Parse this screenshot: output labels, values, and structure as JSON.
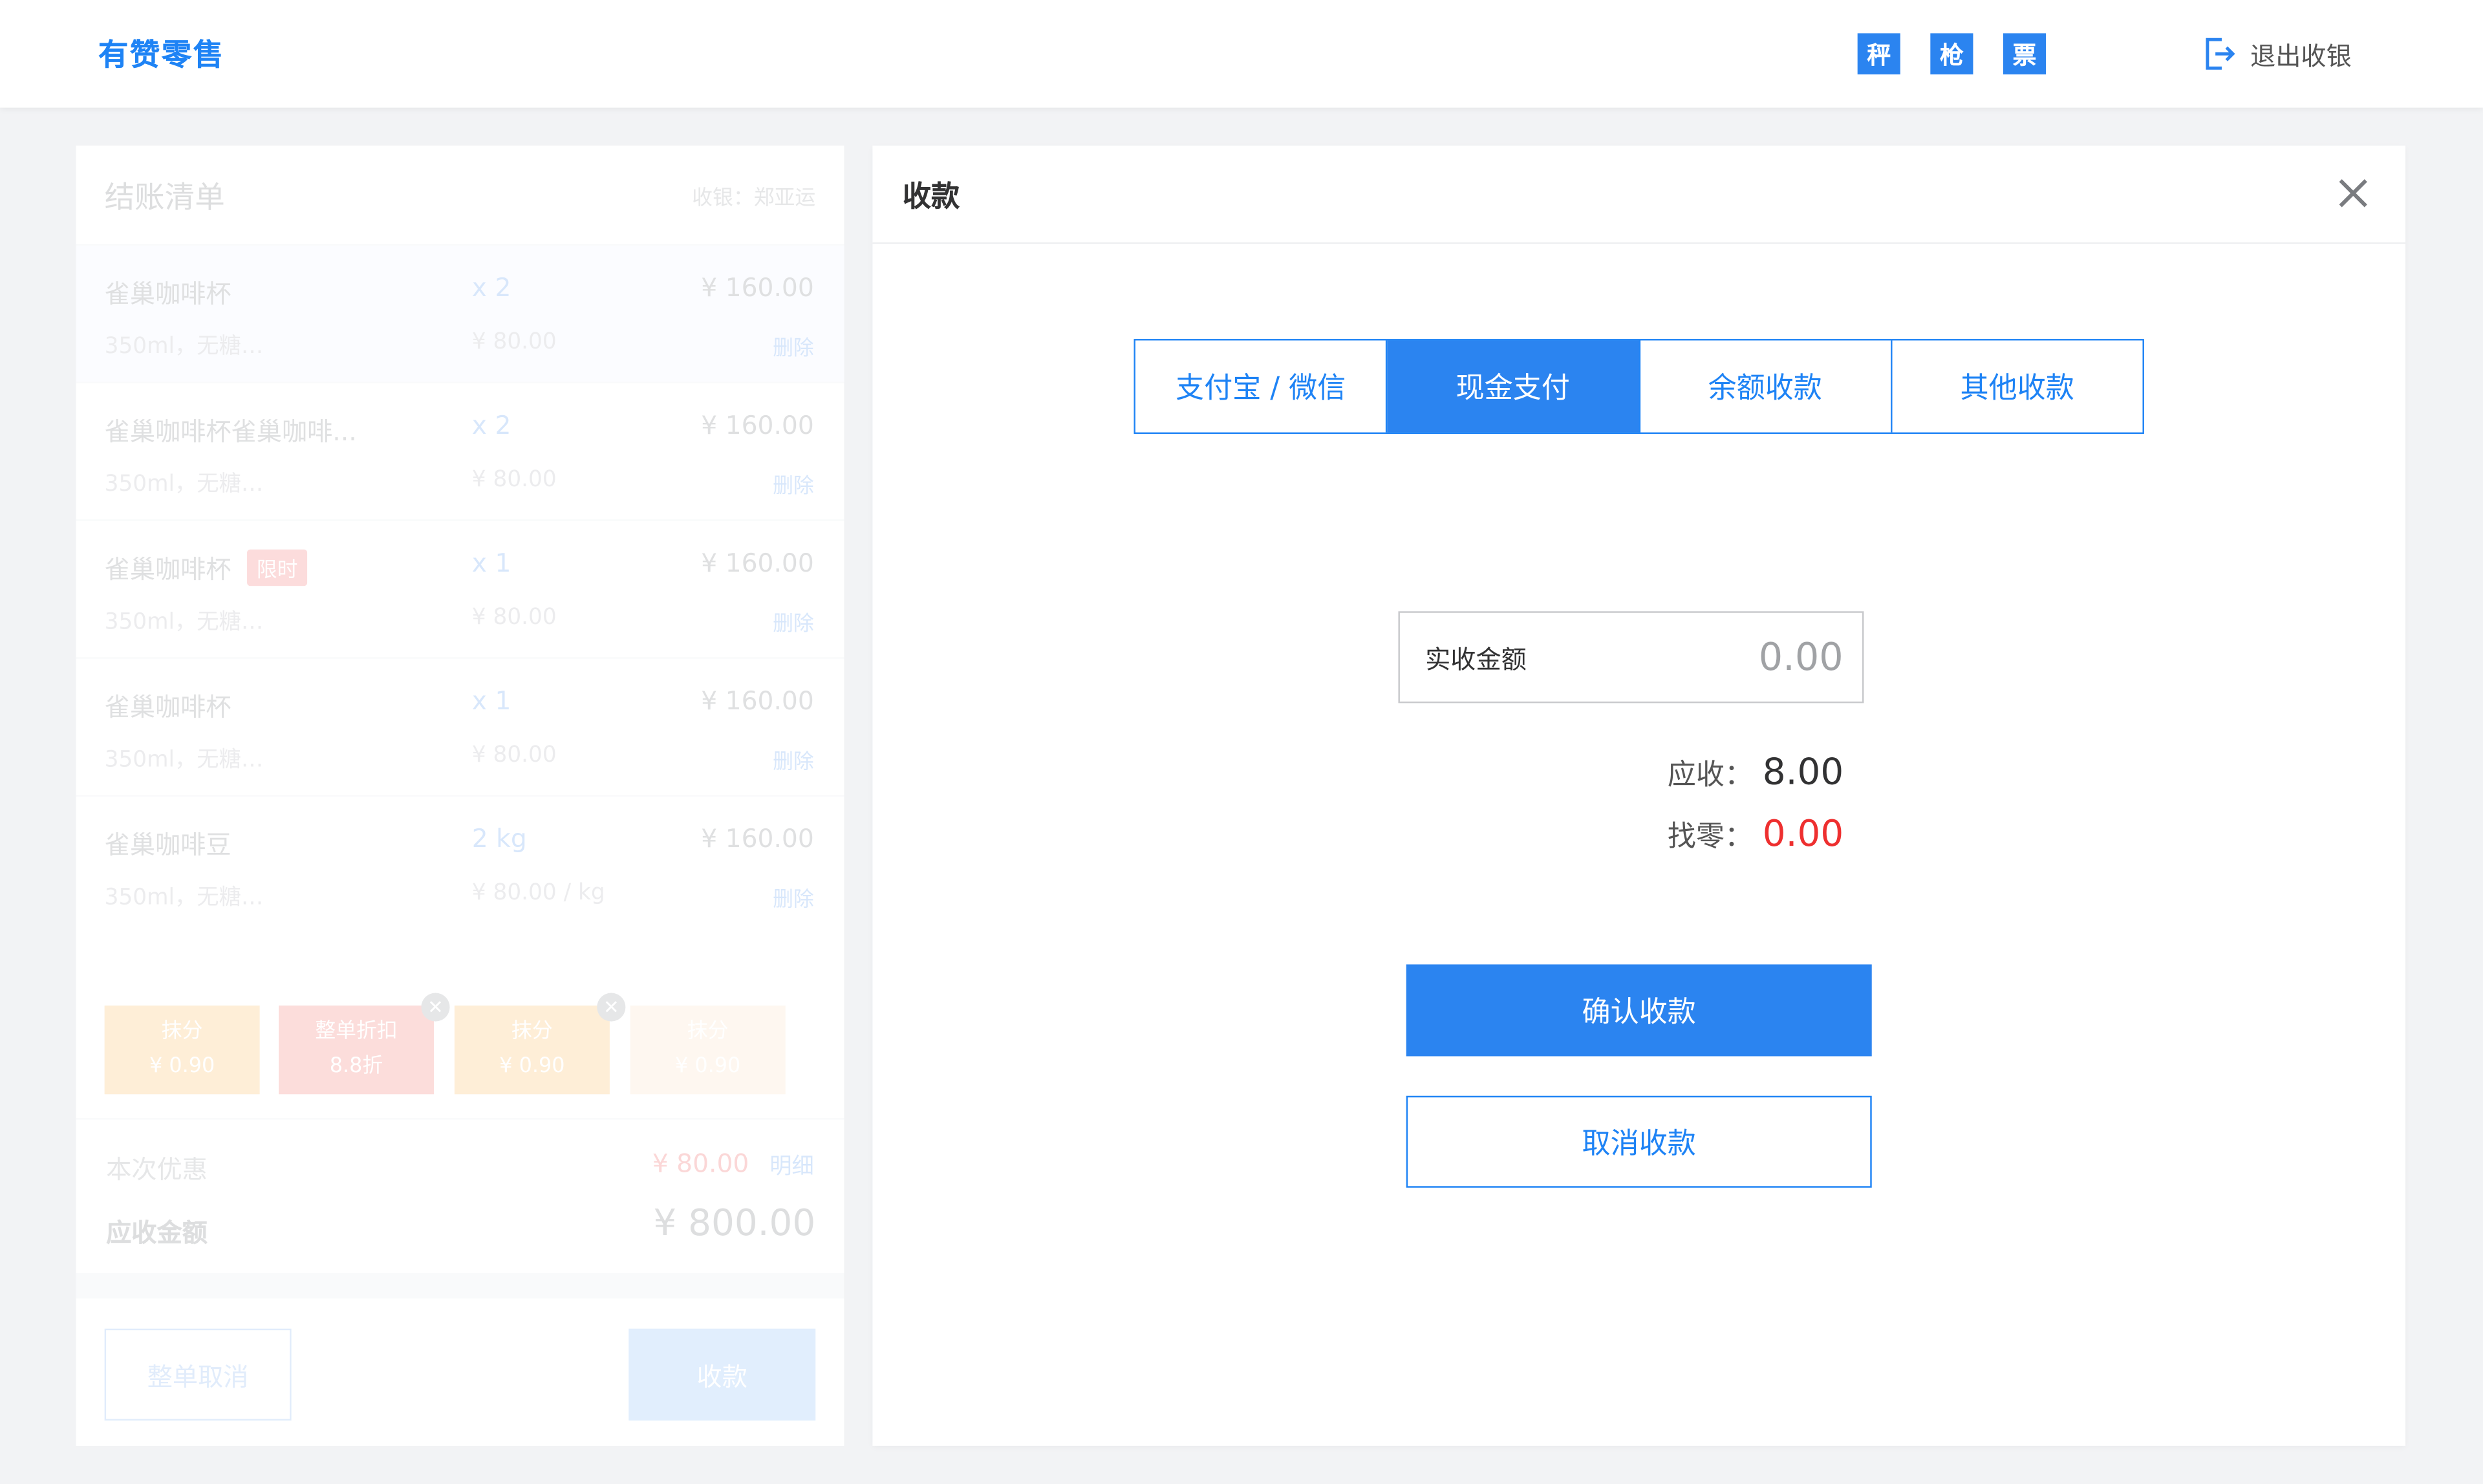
{
  "header": {
    "brand": "有赞零售",
    "hardware": [
      {
        "label": "秤",
        "name": "scale-button"
      },
      {
        "label": "枪",
        "name": "scanner-button"
      },
      {
        "label": "票",
        "name": "printer-button"
      }
    ],
    "exit_label": "退出收银",
    "exit_icon": "logout-icon"
  },
  "checkout": {
    "title": "结账清单",
    "cashier": "收银：郑亚运",
    "items": [
      {
        "name": "雀巢咖啡杯",
        "tag": "",
        "qty": "x 2",
        "price": "¥ 160.00",
        "spec": "350ml，无糖…",
        "unit_price": "¥ 80.00",
        "delete": "删除"
      },
      {
        "name": "雀巢咖啡杯雀巢咖啡...",
        "tag": "",
        "qty": "x 2",
        "price": "¥ 160.00",
        "spec": "350ml，无糖…",
        "unit_price": "¥ 80.00",
        "delete": "删除"
      },
      {
        "name": "雀巢咖啡杯",
        "tag": "限时",
        "qty": "x 1",
        "price": "¥ 160.00",
        "spec": "350ml，无糖…",
        "unit_price": "¥ 80.00",
        "delete": "删除"
      },
      {
        "name": "雀巢咖啡杯",
        "tag": "",
        "qty": "x 1",
        "price": "¥ 160.00",
        "spec": "350ml，无糖…",
        "unit_price": "¥ 80.00",
        "delete": "删除"
      },
      {
        "name": "雀巢咖啡豆",
        "tag": "",
        "qty": "2 kg",
        "price": "¥ 160.00",
        "spec": "350ml，无糖…",
        "unit_price": "¥ 80.00 / kg",
        "delete": "删除"
      }
    ],
    "promotions": [
      {
        "title": "抹分",
        "value": "¥ 0.90",
        "color": "#fcd9a6",
        "removable": false
      },
      {
        "title": "整单折扣",
        "value": "8.8折",
        "color": "#f9b3b0",
        "removable": true
      },
      {
        "title": "抹分",
        "value": "¥ 0.90",
        "color": "#fcd9a6",
        "removable": true
      },
      {
        "title": "抹分",
        "value": "¥ 0.90",
        "color": "#fdeedd",
        "removable": false
      }
    ],
    "discount_label": "本次优惠",
    "discount_value": "¥ 80.00",
    "detail_label": "明细",
    "total_label": "应收金额",
    "total_value": "¥ 800.00",
    "cancel_order_label": "整单取消",
    "pay_label": "收款"
  },
  "payment": {
    "title": "收款",
    "close_icon": "close-icon",
    "tabs": [
      {
        "label": "支付宝 / 微信",
        "active": false
      },
      {
        "label": "现金支付",
        "active": true
      },
      {
        "label": "余额收款",
        "active": false
      },
      {
        "label": "其他收款",
        "active": false
      }
    ],
    "received_label": "实收金额",
    "received_placeholder": "0.00",
    "due_label": "应收：",
    "due_value": "8.00",
    "change_label": "找零：",
    "change_value": "0.00",
    "confirm_label": "确认收款",
    "cancel_label": "取消收款"
  },
  "colors": {
    "accent": "#2b84f0",
    "danger": "#ee2f2f",
    "background": "#f2f3f5"
  }
}
